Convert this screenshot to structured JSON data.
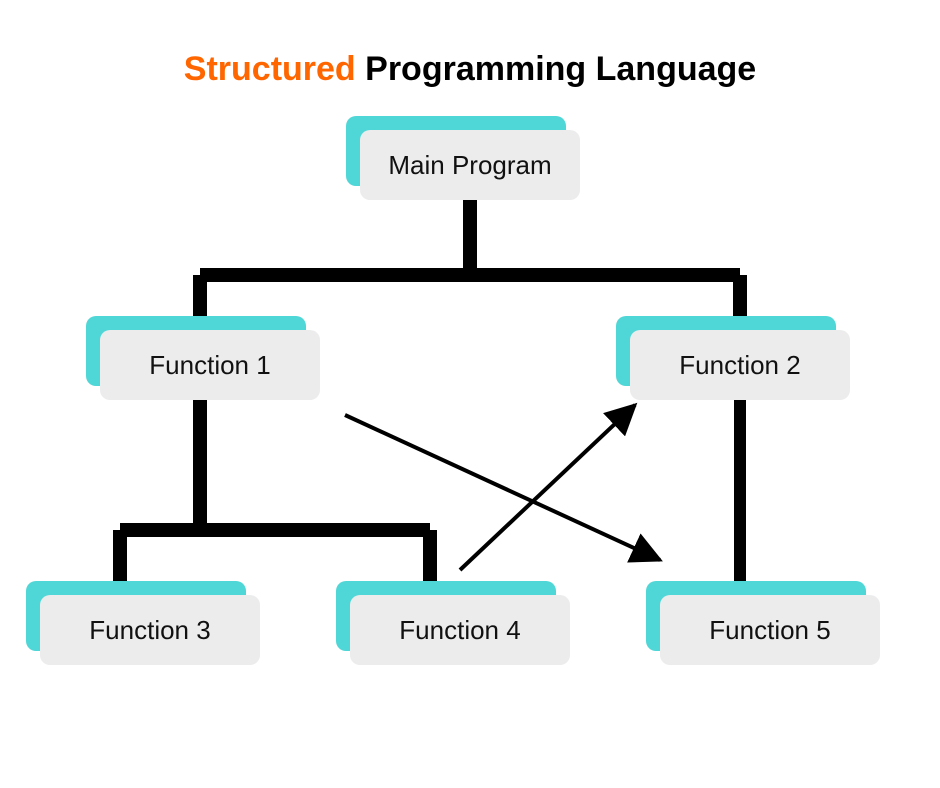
{
  "title": {
    "accent": "Structured",
    "rest": " Programming Language"
  },
  "colors": {
    "accent": "#ff6600",
    "card_shadow": "#4fd6d6",
    "card_front": "#ececec",
    "connector": "#000000"
  },
  "nodes": {
    "main": {
      "label": "Main Program"
    },
    "f1": {
      "label": "Function 1"
    },
    "f2": {
      "label": "Function 2"
    },
    "f3": {
      "label": "Function 3"
    },
    "f4": {
      "label": "Function 4"
    },
    "f5": {
      "label": "Function 5"
    }
  },
  "diagram": {
    "hierarchy": [
      {
        "from": "main",
        "to": "f1"
      },
      {
        "from": "main",
        "to": "f2"
      },
      {
        "from": "f1",
        "to": "f3"
      },
      {
        "from": "f1",
        "to": "f4"
      },
      {
        "from": "f2",
        "to": "f5"
      }
    ],
    "cross_arrows": [
      {
        "from": "f4",
        "to": "f2"
      },
      {
        "from_near": "f1",
        "to_near": "f5"
      }
    ]
  }
}
